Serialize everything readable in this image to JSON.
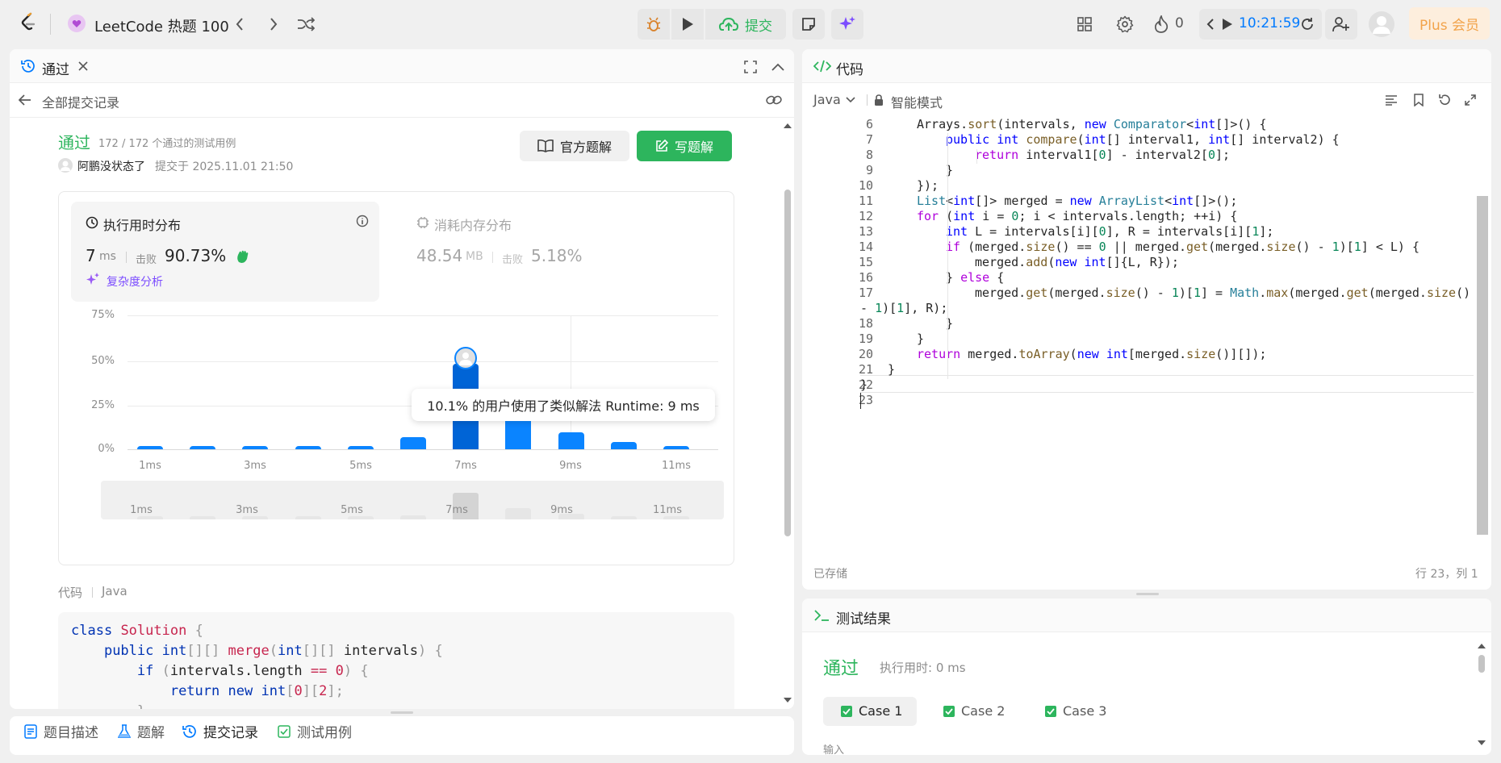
{
  "topbar": {
    "title": "LeetCode 热题 100",
    "submit_label": "提交",
    "fire_count": "0",
    "timer": "10:21:59",
    "plus_label": "Plus 会员"
  },
  "left": {
    "tab_label": "通过",
    "back_label": "全部提交记录",
    "status": "通过",
    "testcases": "172 / 172 个通过的测试用例",
    "user": "阿鹏没状态了",
    "submitted_at": "提交于 2025.11.01 21:50",
    "official_btn": "官方题解",
    "write_btn": "写题解",
    "runtime_title": "执行用时分布",
    "runtime_value": "7",
    "runtime_unit": "ms",
    "beat_label": "击败",
    "runtime_beat": "90.73%",
    "complexity": "复杂度分析",
    "memory_title": "消耗内存分布",
    "memory_value": "48.54",
    "memory_unit": "MB",
    "memory_beat": "5.18%",
    "tooltip": "10.1% 的用户使用了类似解法 Runtime: 9 ms",
    "code_label": "代码",
    "code_lang": "Java",
    "code_lines": [
      "class Solution {",
      "    public int[][] merge(int[][] intervals) {",
      "        if (intervals.length == 0) {",
      "            return new int[0][2];"
    ]
  },
  "chart_data": {
    "type": "bar",
    "x_unit": "ms",
    "categories": [
      "1ms",
      "2ms",
      "3ms",
      "4ms",
      "5ms",
      "6ms",
      "7ms",
      "8ms",
      "9ms",
      "10ms",
      "11ms"
    ],
    "x_tick_labels": [
      "1ms",
      "3ms",
      "5ms",
      "7ms",
      "9ms",
      "11ms"
    ],
    "values": [
      2,
      2,
      2,
      2,
      2,
      7,
      48,
      19.5,
      9.5,
      4,
      2
    ],
    "y_tick_labels": [
      "75%",
      "50%",
      "25%",
      "0%"
    ],
    "ylim": [
      0,
      75
    ],
    "highlight": "7ms",
    "mini_labels": [
      "1ms",
      "3ms",
      "5ms",
      "7ms",
      "9ms",
      "11ms"
    ]
  },
  "editor": {
    "title": "代码",
    "language": "Java",
    "mode": "智能模式",
    "saved": "已存储",
    "cursor": "行 23，列 1"
  },
  "results": {
    "title": "测试结果",
    "status": "通过",
    "runtime": "执行用时: 0 ms",
    "cases": [
      "Case 1",
      "Case 2",
      "Case 3"
    ],
    "input_label": "输入"
  },
  "bottom_tabs": [
    "题目描述",
    "题解",
    "提交记录",
    "测试用例"
  ],
  "colors": {
    "green": "#2db55d",
    "accent": "#007aff",
    "bar": "#0a84ff",
    "plus": "#f2a34a"
  }
}
